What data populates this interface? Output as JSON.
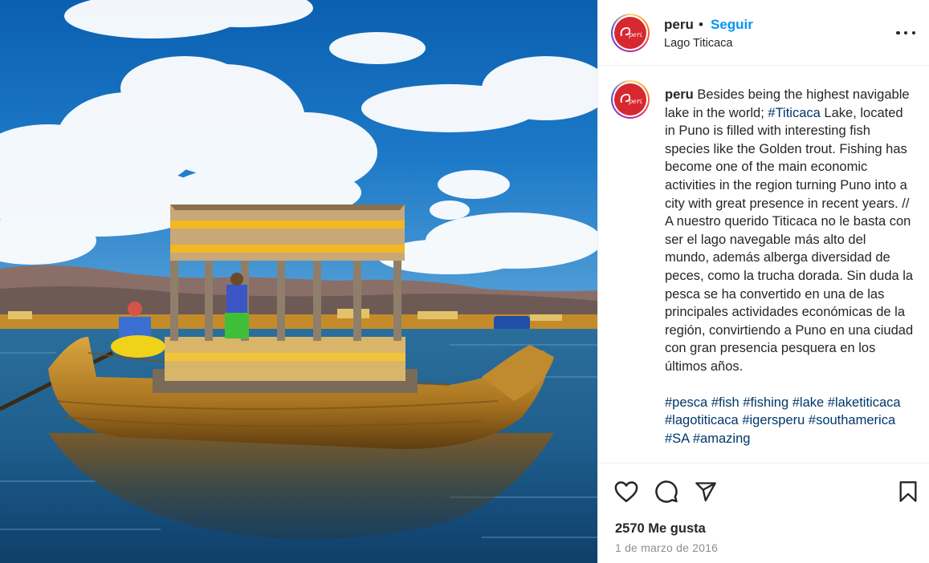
{
  "colors": {
    "accent_link": "#0095f6",
    "hashtag": "#00376b",
    "text": "#262626",
    "muted": "#8e8e8e",
    "avatar_brand": "#d7282f"
  },
  "photo": {
    "alt_semantic": "reed-boat-on-lake-titicaca"
  },
  "header": {
    "username": "peru",
    "separator": "•",
    "follow_label": "Seguir",
    "location": "Lago Titicaca",
    "more_icon": "more-options-icon"
  },
  "caption": {
    "username": "peru",
    "text_before_tag": " Besides being the highest navigable lake in the world; ",
    "inline_tag": "#Titicaca",
    "text_after_tag": " Lake, located in Puno is filled with interesting fish species like the Golden trout. Fishing has become one of the main economic activities in the region turning Puno into a city with great presence in recent years. // A nuestro querido Titicaca no le basta con ser el lago navegable más alto del mundo, además alberga diversidad de peces, como la trucha dorada. Sin duda la pesca se ha convertido en una de las principales actividades económicas de la región, convirtiendo a Puno en una ciudad con gran presencia pesquera en los últimos años.",
    "hashtags": [
      "#pesca",
      "#fish",
      "#fishing",
      "#lake",
      "#laketiticaca",
      "#lagotiticaca",
      "#igersperu",
      "#southamerica",
      "#SA",
      "#amazing"
    ]
  },
  "actions": {
    "like_icon": "heart-icon",
    "comment_icon": "comment-icon",
    "share_icon": "send-icon",
    "save_icon": "bookmark-icon"
  },
  "stats": {
    "likes_text": "2570 Me gusta",
    "date_text": "1 de marzo de 2016"
  }
}
